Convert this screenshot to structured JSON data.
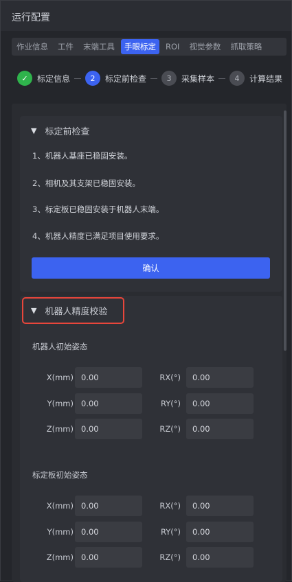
{
  "window": {
    "title": "运行配置"
  },
  "tabs": [
    {
      "label": "作业信息",
      "active": false
    },
    {
      "label": "工件",
      "active": false
    },
    {
      "label": "末端工具",
      "active": false
    },
    {
      "label": "手眼标定",
      "active": true
    },
    {
      "label": "ROI",
      "active": false
    },
    {
      "label": "视觉参数",
      "active": false
    },
    {
      "label": "抓取策略",
      "active": false
    }
  ],
  "steps": [
    {
      "number": "✓",
      "label": "标定信息",
      "state": "done"
    },
    {
      "number": "2",
      "label": "标定前检查",
      "state": "current"
    },
    {
      "number": "3",
      "label": "采集样本",
      "state": "todo"
    },
    {
      "number": "4",
      "label": "计算结果",
      "state": "todo"
    }
  ],
  "precheck": {
    "title": "标定前检查",
    "items": [
      "1、机器人基座已稳固安装。",
      "2、相机及其支架已稳固安装。",
      "3、标定板已稳固安装于机器人末端。",
      "4、机器人精度已满足项目使用要求。"
    ],
    "confirm_label": "确认"
  },
  "accuracy": {
    "title": "机器人精度校验",
    "robot_pose": {
      "title": "机器人初始姿态",
      "fields": {
        "x": {
          "label": "X(mm)",
          "value": "0.00"
        },
        "y": {
          "label": "Y(mm)",
          "value": "0.00"
        },
        "z": {
          "label": "Z(mm)",
          "value": "0.00"
        },
        "rx": {
          "label": "RX(°)",
          "value": "0.00"
        },
        "ry": {
          "label": "RY(°)",
          "value": "0.00"
        },
        "rz": {
          "label": "RZ(°)",
          "value": "0.00"
        }
      }
    },
    "board_pose": {
      "title": "标定板初始姿态",
      "fields": {
        "x": {
          "label": "X(mm)",
          "value": "0.00"
        },
        "y": {
          "label": "Y(mm)",
          "value": "0.00"
        },
        "z": {
          "label": "Z(mm)",
          "value": "0.00"
        },
        "rx": {
          "label": "RX(°)",
          "value": "0.00"
        },
        "ry": {
          "label": "RY(°)",
          "value": "0.00"
        },
        "rz": {
          "label": "RZ(°)",
          "value": "0.00"
        }
      }
    }
  },
  "colors": {
    "accent": "#3c63f0",
    "done": "#2fb34c",
    "highlight": "#e8463b"
  }
}
